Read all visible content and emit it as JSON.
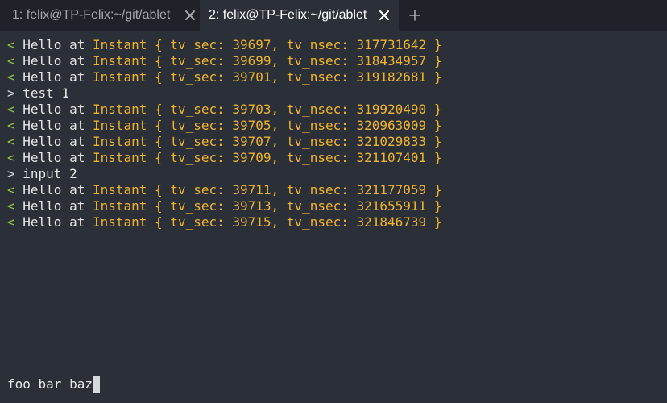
{
  "tabs": [
    {
      "label": "1: felix@TP-Felix:~/git/ablet",
      "active": false
    },
    {
      "label": "2: felix@TP-Felix:~/git/ablet",
      "active": true
    }
  ],
  "new_tab_icon": "plus-icon",
  "close_icon": "close-icon",
  "colors": {
    "background": "#2b3038",
    "tabbar": "#1f2329",
    "incoming_prompt": "#8ec73e",
    "instant_text": "#f0b429",
    "plain_text": "#e6e6e6"
  },
  "output": [
    {
      "prompt": "<",
      "kind": "incoming",
      "text": " Hello at ",
      "instant": "Instant { tv_sec: 39697, tv_nsec: 317731642 }"
    },
    {
      "prompt": "<",
      "kind": "incoming",
      "text": " Hello at ",
      "instant": "Instant { tv_sec: 39699, tv_nsec: 318434957 }"
    },
    {
      "prompt": "<",
      "kind": "incoming",
      "text": " Hello at ",
      "instant": "Instant { tv_sec: 39701, tv_nsec: 319182681 }"
    },
    {
      "prompt": ">",
      "kind": "outgoing",
      "text": " test 1",
      "instant": ""
    },
    {
      "prompt": "<",
      "kind": "incoming",
      "text": " Hello at ",
      "instant": "Instant { tv_sec: 39703, tv_nsec: 319920490 }"
    },
    {
      "prompt": "<",
      "kind": "incoming",
      "text": " Hello at ",
      "instant": "Instant { tv_sec: 39705, tv_nsec: 320963009 }"
    },
    {
      "prompt": "<",
      "kind": "incoming",
      "text": " Hello at ",
      "instant": "Instant { tv_sec: 39707, tv_nsec: 321029833 }"
    },
    {
      "prompt": "<",
      "kind": "incoming",
      "text": " Hello at ",
      "instant": "Instant { tv_sec: 39709, tv_nsec: 321107401 }"
    },
    {
      "prompt": ">",
      "kind": "outgoing",
      "text": " input 2",
      "instant": ""
    },
    {
      "prompt": "<",
      "kind": "incoming",
      "text": " Hello at ",
      "instant": "Instant { tv_sec: 39711, tv_nsec: 321177059 }"
    },
    {
      "prompt": "<",
      "kind": "incoming",
      "text": " Hello at ",
      "instant": "Instant { tv_sec: 39713, tv_nsec: 321655911 }"
    },
    {
      "prompt": "<",
      "kind": "incoming",
      "text": " Hello at ",
      "instant": "Instant { tv_sec: 39715, tv_nsec: 321846739 }"
    }
  ],
  "input": {
    "value": "foo bar baz"
  }
}
